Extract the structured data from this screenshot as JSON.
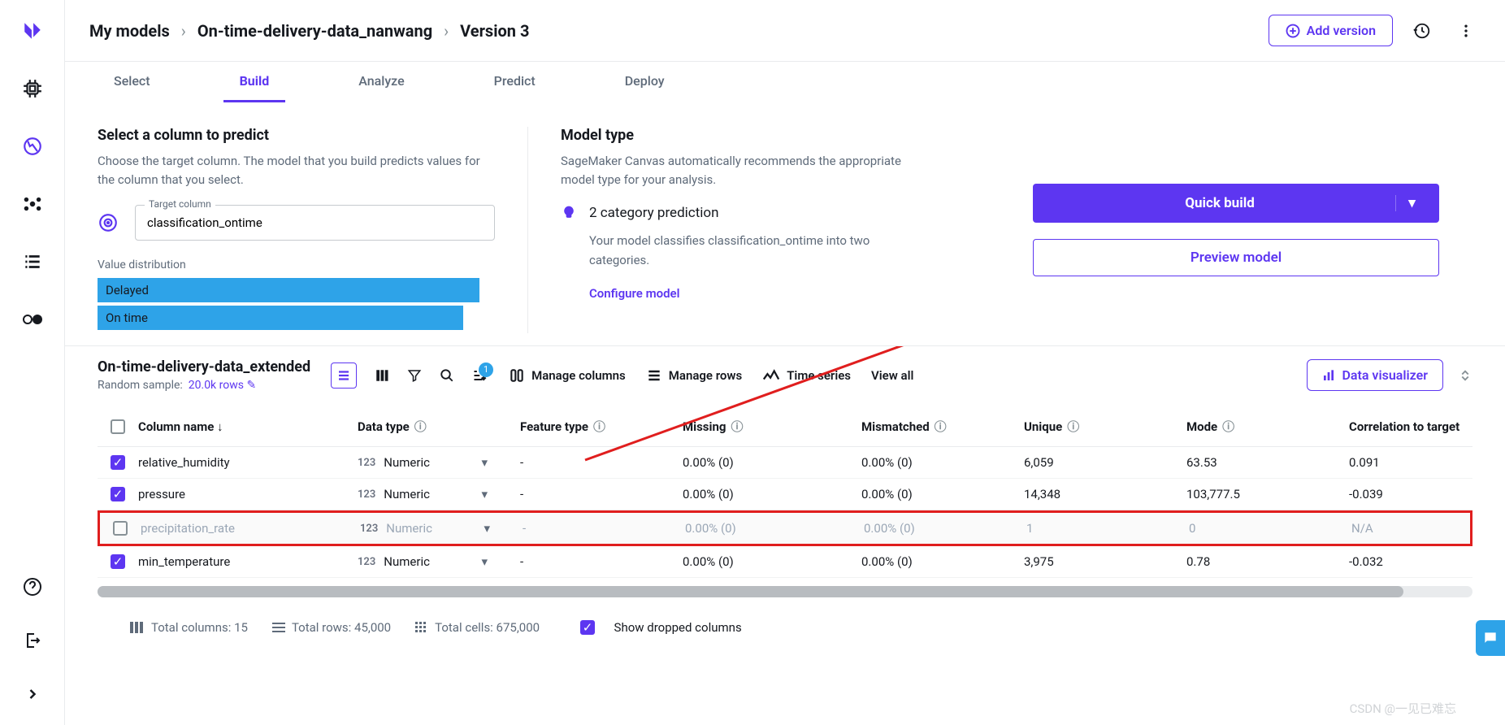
{
  "breadcrumb": {
    "root": "My models",
    "project": "On-time-delivery-data_nanwang",
    "version": "Version 3"
  },
  "topbar": {
    "add_version": "Add version"
  },
  "tabs": [
    "Select",
    "Build",
    "Analyze",
    "Predict",
    "Deploy"
  ],
  "left_panel": {
    "title": "Select a column to predict",
    "sub": "Choose the target column. The model that you build predicts values for the column that you select.",
    "target_label": "Target column",
    "target_value": "classification_ontime",
    "vd_label": "Value distribution",
    "bars": [
      "Delayed",
      "On time"
    ]
  },
  "mid_panel": {
    "title": "Model type",
    "sub": "SageMaker Canvas automatically recommends the appropriate model type for your analysis.",
    "cat_title": "2 category prediction",
    "cat_sub": "Your model classifies classification_ontime into two categories.",
    "configure": "Configure model"
  },
  "right_panel": {
    "quick": "Quick build",
    "preview": "Preview model"
  },
  "dataset": {
    "name": "On-time-delivery-data_extended",
    "sample_label": "Random sample:",
    "sample_link": "20.0k rows",
    "manage_columns": "Manage columns",
    "manage_rows": "Manage rows",
    "time_series": "Time series",
    "view_all": "View all",
    "data_viz": "Data visualizer",
    "sort_badge": "1"
  },
  "columns": {
    "headers": [
      "",
      "Column name ↓",
      "Data type",
      "Feature type",
      "Missing",
      "Mismatched",
      "Unique",
      "Mode",
      "Correlation to target"
    ],
    "rows": [
      {
        "checked": true,
        "name": "relative_humidity",
        "pre": "123",
        "dtype": "Numeric",
        "ftype": "-",
        "missing": "0.00% (0)",
        "mismatched": "0.00% (0)",
        "unique": "6,059",
        "mode": "63.53",
        "corr": "0.091"
      },
      {
        "checked": true,
        "name": "pressure",
        "pre": "123",
        "dtype": "Numeric",
        "ftype": "-",
        "missing": "0.00% (0)",
        "mismatched": "0.00% (0)",
        "unique": "14,348",
        "mode": "103,777.5",
        "corr": "-0.039"
      },
      {
        "checked": false,
        "name": "precipitation_rate",
        "pre": "123",
        "dtype": "Numeric",
        "ftype": "-",
        "missing": "0.00% (0)",
        "mismatched": "0.00% (0)",
        "unique": "1",
        "mode": "0",
        "corr": "N/A",
        "highlight": true
      },
      {
        "checked": true,
        "name": "min_temperature",
        "pre": "123",
        "dtype": "Numeric",
        "ftype": "-",
        "missing": "0.00% (0)",
        "mismatched": "0.00% (0)",
        "unique": "3,975",
        "mode": "0.78",
        "corr": "-0.032"
      }
    ]
  },
  "footer": {
    "cols": "Total columns: 15",
    "rows": "Total rows: 45,000",
    "cells": "Total cells: 675,000",
    "show_dropped": "Show dropped columns"
  },
  "watermark": "CSDN @一见已难忘"
}
